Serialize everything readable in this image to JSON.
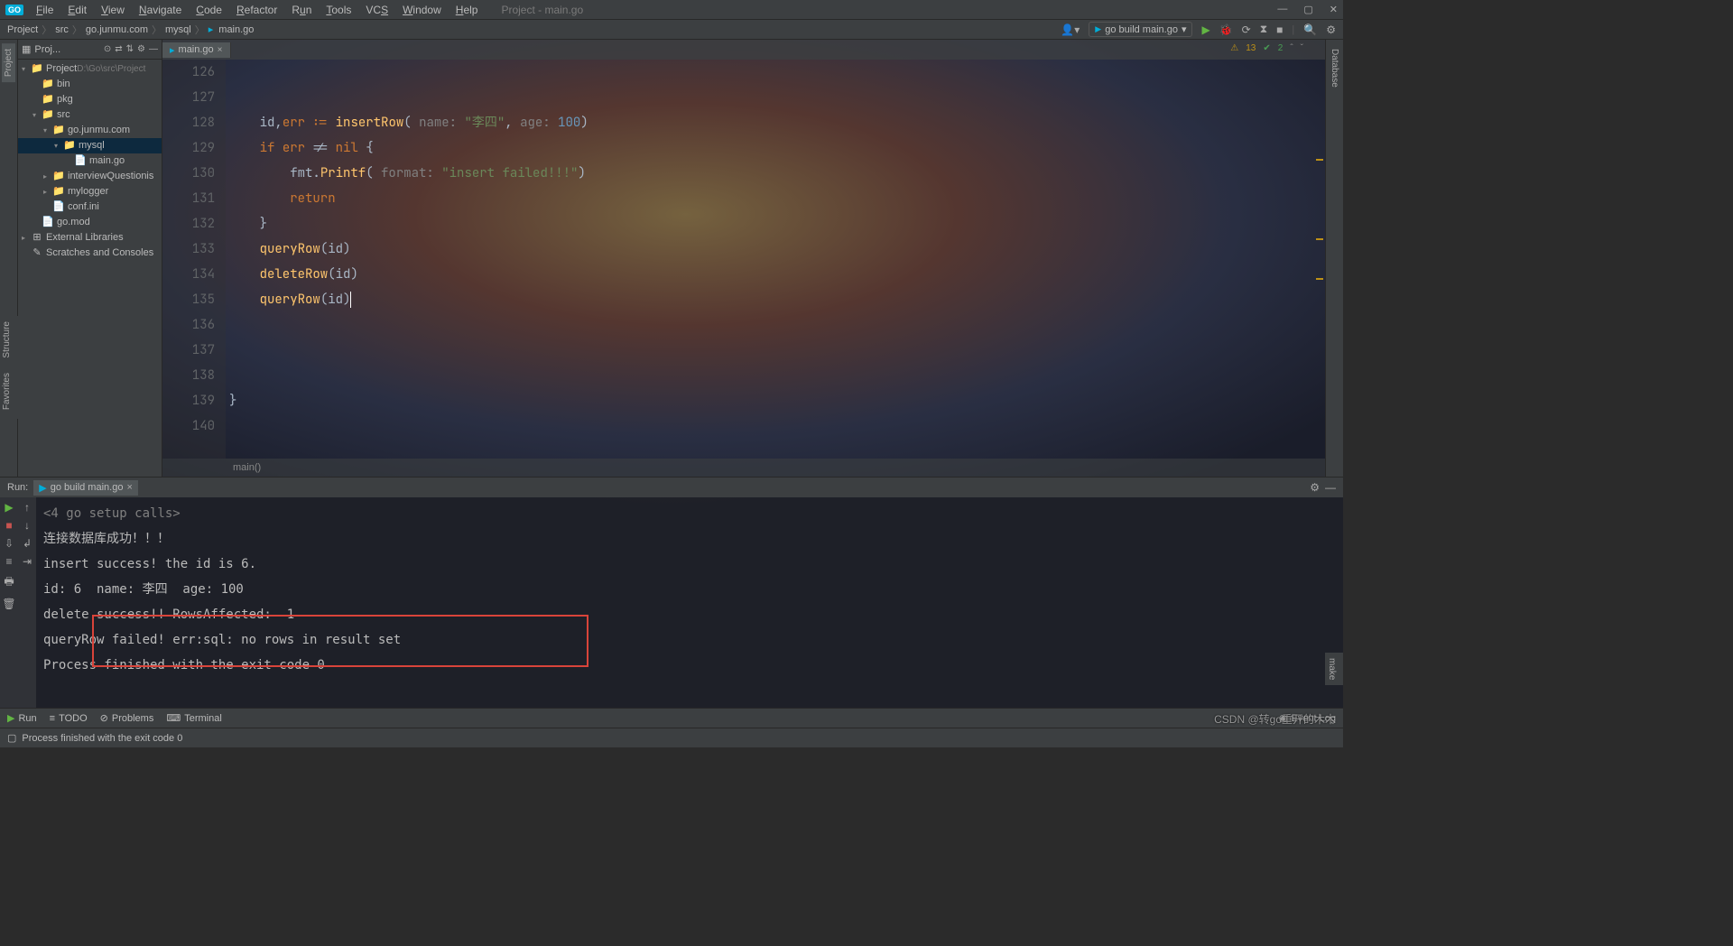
{
  "window_title": "Project - main.go",
  "menu": [
    "File",
    "Edit",
    "View",
    "Navigate",
    "Code",
    "Refactor",
    "Run",
    "Tools",
    "VCS",
    "Window",
    "Help"
  ],
  "breadcrumb": [
    "Project",
    "src",
    "go.junmu.com",
    "mysql",
    "main.go"
  ],
  "run_config": "go build main.go",
  "inspections": {
    "warnings": "13",
    "passes": "2"
  },
  "project": {
    "panel_title": "Proj...",
    "root": {
      "name": "Project",
      "path": "D:\\Go\\src\\Project"
    },
    "tree": [
      {
        "depth": 0,
        "arrow": "v",
        "icon": "folder",
        "label": "Project",
        "suffix": "D:\\Go\\src\\Project"
      },
      {
        "depth": 1,
        "arrow": "",
        "icon": "folder",
        "label": "bin"
      },
      {
        "depth": 1,
        "arrow": "",
        "icon": "folder",
        "label": "pkg"
      },
      {
        "depth": 1,
        "arrow": "v",
        "icon": "folder",
        "label": "src"
      },
      {
        "depth": 2,
        "arrow": "v",
        "icon": "folder",
        "label": "go.junmu.com"
      },
      {
        "depth": 3,
        "arrow": "v",
        "icon": "folder",
        "label": "mysql",
        "selected": true
      },
      {
        "depth": 4,
        "arrow": "",
        "icon": "go",
        "label": "main.go"
      },
      {
        "depth": 2,
        "arrow": ">",
        "icon": "folder",
        "label": "interviewQuestionis"
      },
      {
        "depth": 2,
        "arrow": ">",
        "icon": "folder",
        "label": "mylogger"
      },
      {
        "depth": 2,
        "arrow": "",
        "icon": "file",
        "label": "conf.ini"
      },
      {
        "depth": 1,
        "arrow": "",
        "icon": "go",
        "label": "go.mod"
      },
      {
        "depth": 0,
        "arrow": ">",
        "icon": "lib",
        "label": "External Libraries"
      },
      {
        "depth": 0,
        "arrow": "",
        "icon": "scratch",
        "label": "Scratches and Consoles"
      }
    ]
  },
  "editor": {
    "tab": "main.go",
    "first_line": 126,
    "lines": [
      "",
      "",
      "    id,err := insertRow( name: \"李四\", age: 100)",
      "    if err != nil {",
      "        fmt.Printf( format: \"insert failed!!!\")",
      "        return",
      "    }",
      "    queryRow(id)",
      "    deleteRow(id)",
      "    queryRow(id)",
      "",
      "",
      "",
      "}",
      ""
    ],
    "footer": "main()"
  },
  "run": {
    "label": "Run:",
    "tab": "go build main.go",
    "output": [
      "<4 go setup calls>",
      "连接数据库成功！！！",
      "insert success! the id is 6.",
      "id: 6  name: 李四  age: 100",
      "delete success!! RowsAffected:  1",
      "queryRow failed! err:sql: no rows in result set",
      "Process finished with the exit code 0"
    ]
  },
  "bottom_tabs": [
    "Run",
    "TODO",
    "Problems",
    "Terminal"
  ],
  "status_text": "Process finished with the exit code 0",
  "event_log": "Event Log",
  "watermark": "CSDN @转go重开的木木",
  "side": {
    "left_top": "Project",
    "left_bottom": [
      "Structure",
      "Favorites"
    ],
    "right": "Database",
    "right_bottom": "make"
  }
}
